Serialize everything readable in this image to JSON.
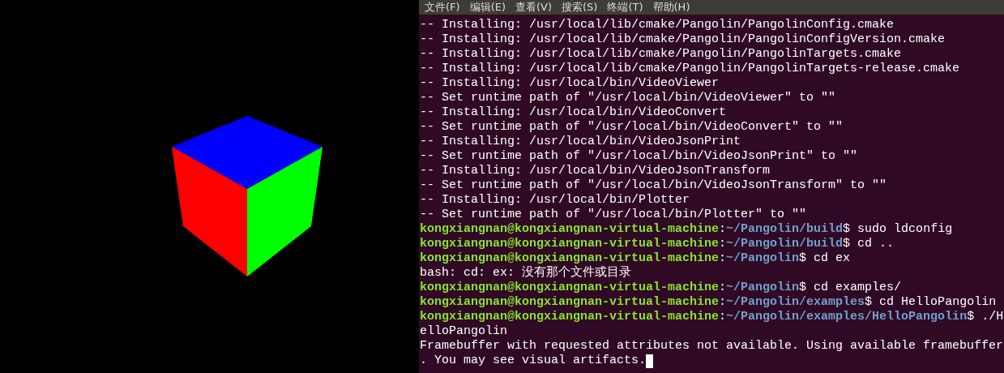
{
  "viewer": {
    "kind": "cube"
  },
  "terminal": {
    "menu": [
      "文件(F)",
      "编辑(E)",
      "查看(V)",
      "搜索(S)",
      "终端(T)",
      "帮助(H)"
    ],
    "cursor": true,
    "lines": [
      {
        "kind": "output",
        "text": "-- Installing: /usr/local/lib/cmake/Pangolin/PangolinConfig.cmake"
      },
      {
        "kind": "output",
        "text": "-- Installing: /usr/local/lib/cmake/Pangolin/PangolinConfigVersion.cmake"
      },
      {
        "kind": "output",
        "text": "-- Installing: /usr/local/lib/cmake/Pangolin/PangolinTargets.cmake"
      },
      {
        "kind": "output",
        "text": "-- Installing: /usr/local/lib/cmake/Pangolin/PangolinTargets-release.cmake"
      },
      {
        "kind": "output",
        "text": "-- Installing: /usr/local/bin/VideoViewer"
      },
      {
        "kind": "output",
        "text": "-- Set runtime path of \"/usr/local/bin/VideoViewer\" to \"\""
      },
      {
        "kind": "output",
        "text": "-- Installing: /usr/local/bin/VideoConvert"
      },
      {
        "kind": "output",
        "text": "-- Set runtime path of \"/usr/local/bin/VideoConvert\" to \"\""
      },
      {
        "kind": "output",
        "text": "-- Installing: /usr/local/bin/VideoJsonPrint"
      },
      {
        "kind": "output",
        "text": "-- Set runtime path of \"/usr/local/bin/VideoJsonPrint\" to \"\""
      },
      {
        "kind": "output",
        "text": "-- Installing: /usr/local/bin/VideoJsonTransform"
      },
      {
        "kind": "output",
        "text": "-- Set runtime path of \"/usr/local/bin/VideoJsonTransform\" to \"\""
      },
      {
        "kind": "output",
        "text": "-- Installing: /usr/local/bin/Plotter"
      },
      {
        "kind": "output",
        "text": "-- Set runtime path of \"/usr/local/bin/Plotter\" to \"\""
      },
      {
        "kind": "prompt",
        "user": "kongxiangnan@kongxiangnan-virtual-machine",
        "sep": ":",
        "path": "~/Pangolin/build",
        "command": "$ sudo ldconfig"
      },
      {
        "kind": "prompt",
        "user": "kongxiangnan@kongxiangnan-virtual-machine",
        "sep": ":",
        "path": "~/Pangolin/build",
        "command": "$ cd .."
      },
      {
        "kind": "prompt",
        "user": "kongxiangnan@kongxiangnan-virtual-machine",
        "sep": ":",
        "path": "~/Pangolin",
        "command": "$ cd ex"
      },
      {
        "kind": "output",
        "text": "bash: cd: ex: 没有那个文件或目录"
      },
      {
        "kind": "prompt",
        "user": "kongxiangnan@kongxiangnan-virtual-machine",
        "sep": ":",
        "path": "~/Pangolin",
        "command": "$ cd examples/"
      },
      {
        "kind": "prompt",
        "user": "kongxiangnan@kongxiangnan-virtual-machine",
        "sep": ":",
        "path": "~/Pangolin/examples",
        "command": "$ cd HelloPangolin"
      },
      {
        "kind": "prompt",
        "user": "kongxiangnan@kongxiangnan-virtual-machine",
        "sep": ":",
        "path": "~/Pangolin/examples/HelloPangolin",
        "command": "$ ./H"
      },
      {
        "kind": "output",
        "text": "elloPangolin"
      },
      {
        "kind": "output",
        "text": "Framebuffer with requested attributes not available. Using available framebuffer"
      },
      {
        "kind": "output",
        "text": ". You may see visual artifacts."
      }
    ]
  }
}
